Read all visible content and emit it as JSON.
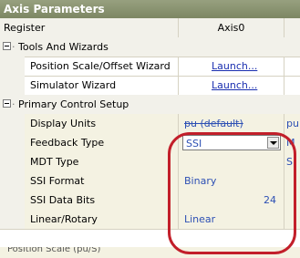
{
  "window": {
    "title": "Axis Parameters"
  },
  "header": {
    "register": "Register",
    "axis": "Axis0",
    "extra": ""
  },
  "categories": {
    "tools": "Tools And Wizards",
    "primary": "Primary Control Setup"
  },
  "rows": {
    "position_scale": {
      "label": "Position Scale/Offset Wizard",
      "value": "Launch..."
    },
    "simulator": {
      "label": "Simulator Wizard",
      "value": "Launch..."
    },
    "display_units": {
      "label": "Display Units",
      "value": "pu (default)",
      "extra": "pu"
    },
    "feedback_type": {
      "label": "Feedback Type",
      "value": "SSI",
      "extra": "M"
    },
    "mdt_type": {
      "label": "MDT Type",
      "value": "",
      "extra": "S"
    },
    "ssi_format": {
      "label": "SSI Format",
      "value": "Binary",
      "extra": ""
    },
    "ssi_data_bits": {
      "label": "SSI Data Bits",
      "value": "24",
      "extra": ""
    },
    "linear_rotary": {
      "label": "Linear/Rotary",
      "value": "Linear",
      "extra": ""
    }
  },
  "partial_row": {
    "label": "Position Scale (pu/S)"
  },
  "colors": {
    "title_bar": "#8c9670",
    "highlight": "#c21f2a",
    "value_text": "#2d50b4"
  }
}
